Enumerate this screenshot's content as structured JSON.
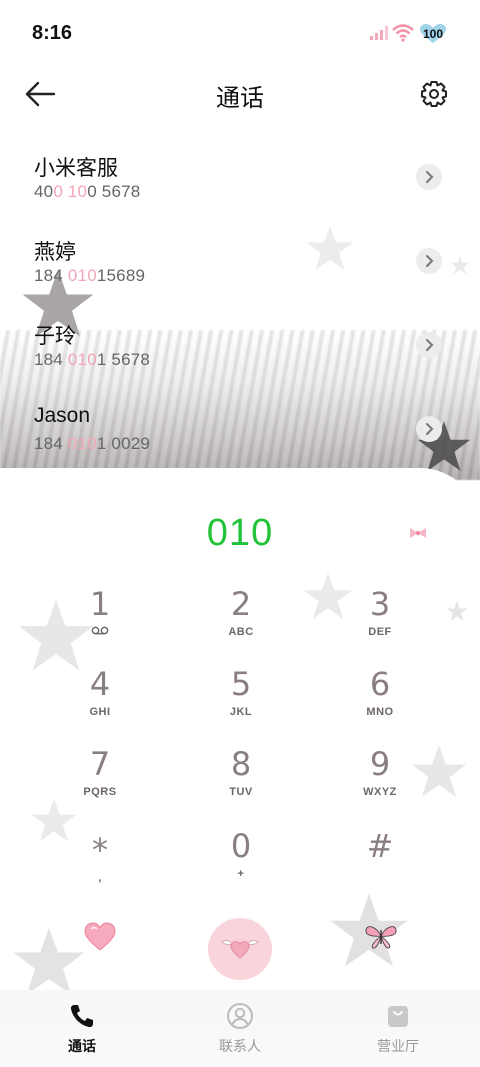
{
  "status_bar": {
    "time": "8:16",
    "battery": "100"
  },
  "header": {
    "title": "通话",
    "icons": [
      "back-arrow-icon",
      "gear-icon"
    ]
  },
  "recents": [
    {
      "name": "小米客服",
      "number_parts": [
        "40",
        "0",
        " ",
        "10",
        "0 5678"
      ]
    },
    {
      "name": "燕婷",
      "number_parts": [
        "184 ",
        "010",
        "15689",
        "",
        ""
      ]
    },
    {
      "name": "子玲",
      "number_parts": [
        "184 ",
        "010",
        "1 5678",
        "",
        ""
      ]
    },
    {
      "name": "Jason",
      "number_parts": [
        "184 ",
        "010",
        "1 0029",
        "",
        ""
      ]
    }
  ],
  "dialer": {
    "input_value": "010",
    "keys": [
      {
        "digit": "1",
        "letters": ""
      },
      {
        "digit": "2",
        "letters": "ABC"
      },
      {
        "digit": "3",
        "letters": "DEF"
      },
      {
        "digit": "4",
        "letters": "GHI"
      },
      {
        "digit": "5",
        "letters": "JKL"
      },
      {
        "digit": "6",
        "letters": "MNO"
      },
      {
        "digit": "7",
        "letters": "PQRS"
      },
      {
        "digit": "8",
        "letters": "TUV"
      },
      {
        "digit": "9",
        "letters": "WXYZ"
      },
      {
        "digit": "*",
        "letters": ","
      },
      {
        "digit": "0",
        "letters": "+"
      },
      {
        "digit": "#",
        "letters": ""
      }
    ]
  },
  "bottom_nav": [
    {
      "label": "通话",
      "icon": "phone-icon",
      "active": true
    },
    {
      "label": "联系人",
      "icon": "contact-icon",
      "active": false
    },
    {
      "label": "营业厅",
      "icon": "bag-icon",
      "active": false
    }
  ],
  "colors": {
    "accent_green": "#22c33a",
    "highlight_pink": "#f2a6b8",
    "call_button_bg": "#f9d5db",
    "key_digit": "#8a7f80"
  }
}
